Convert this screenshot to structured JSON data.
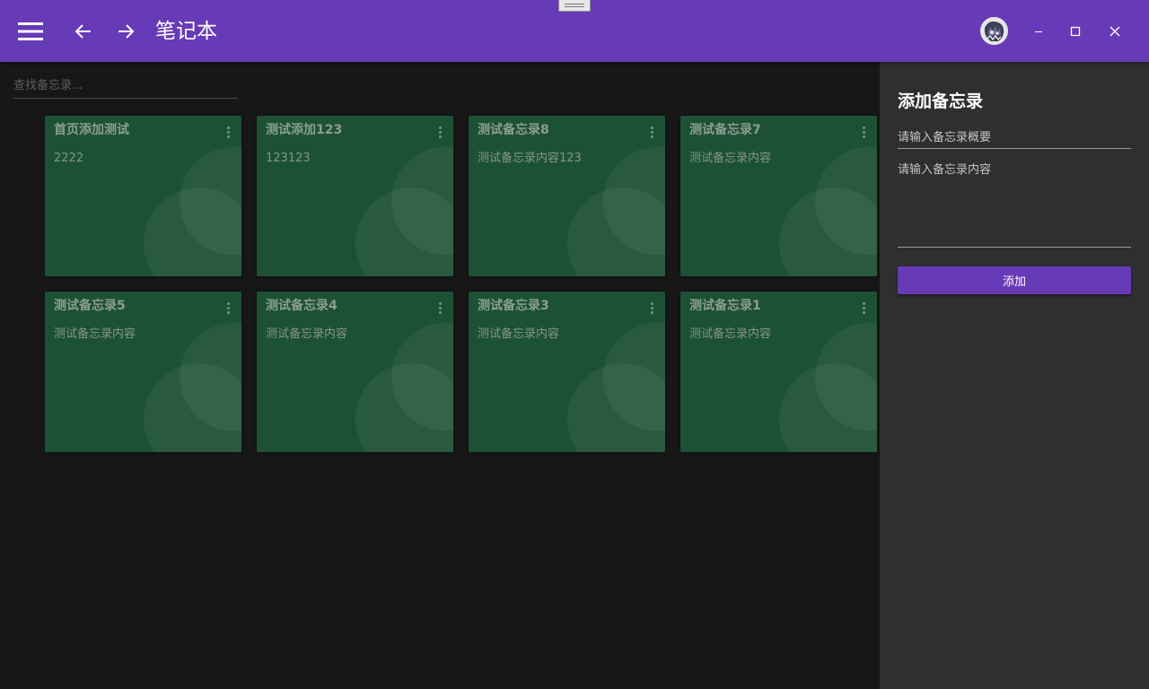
{
  "window": {
    "title": "笔记本",
    "accent_color": "#673ab7",
    "icons": {
      "menu": "hamburger-menu-icon",
      "back": "arrow-left-icon",
      "forward": "arrow-right-icon",
      "minimize": "minimize-icon",
      "maximize": "maximize-icon",
      "close": "close-icon"
    }
  },
  "search": {
    "placeholder": "查找备忘录...",
    "value": ""
  },
  "notes": [
    {
      "title": "首页添加测试",
      "content": "2222"
    },
    {
      "title": "测试添加123",
      "content": "123123"
    },
    {
      "title": "测试备忘录8",
      "content": "测试备忘录内容123"
    },
    {
      "title": "测试备忘录7",
      "content": "测试备忘录内容"
    },
    {
      "title": "测试备忘录5",
      "content": "测试备忘录内容"
    },
    {
      "title": "测试备忘录4",
      "content": "测试备忘录内容"
    },
    {
      "title": "测试备忘录3",
      "content": "测试备忘录内容"
    },
    {
      "title": "测试备忘录1",
      "content": "测试备忘录内容"
    }
  ],
  "note_card_color": "#1d5135",
  "panel": {
    "title": "添加备忘录",
    "summary_placeholder": "请输入备忘录概要",
    "summary_value": "",
    "content_placeholder": "请输入备忘录内容",
    "content_value": "",
    "add_button_label": "添加"
  }
}
